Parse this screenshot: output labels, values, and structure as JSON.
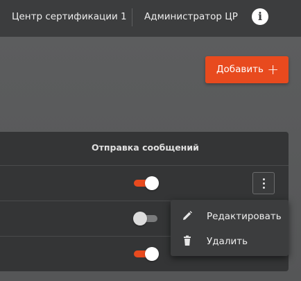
{
  "header": {
    "organization": "Центр сертификации 1",
    "user": "Администратор ЦР",
    "info_icon": "info-icon",
    "info_glyph": "i"
  },
  "toolbar": {
    "add_label": "Добавить",
    "add_icon": "plus-icon",
    "add_glyph": "+"
  },
  "table": {
    "columns": [
      "Отправка сообщений"
    ],
    "rows": [
      {
        "messaging_enabled": true
      },
      {
        "messaging_enabled": false
      },
      {
        "messaging_enabled": true
      }
    ]
  },
  "row_menu": {
    "icon": "more-vertical-icon",
    "items": [
      {
        "label": "Редактировать",
        "icon": "pencil-icon"
      },
      {
        "label": "Удалить",
        "icon": "trash-icon"
      }
    ]
  },
  "colors": {
    "accent": "#e84a1e",
    "header_bg": "#3c3d3e",
    "table_bg": "#343536",
    "page_bg": "#5a5b5c"
  }
}
